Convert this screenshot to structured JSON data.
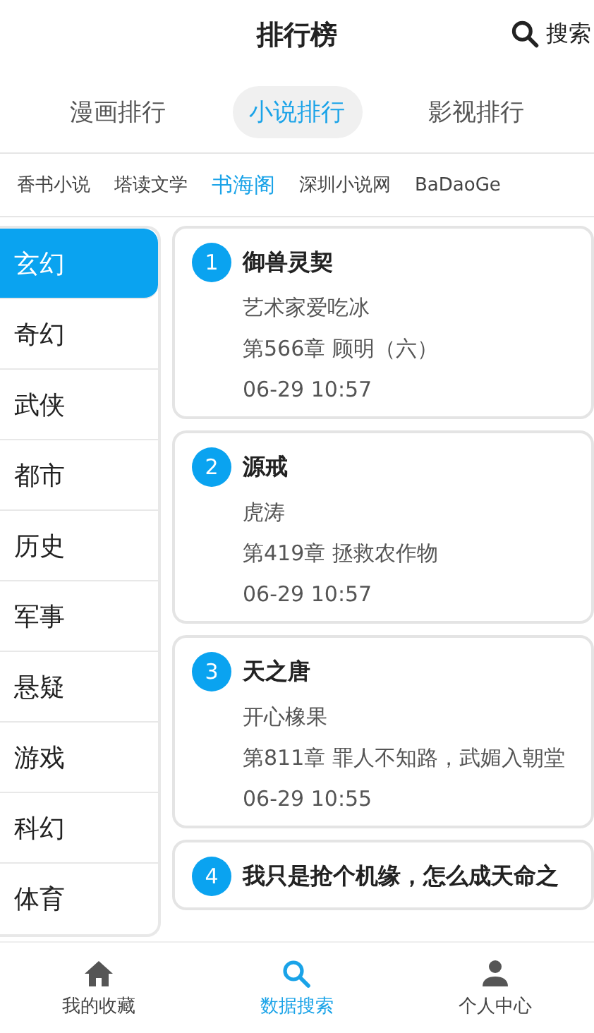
{
  "header": {
    "title": "排行榜",
    "search_label": "搜索"
  },
  "tabs": [
    {
      "label": "漫画排行",
      "selected": false
    },
    {
      "label": "小说排行",
      "selected": true
    },
    {
      "label": "影视排行",
      "selected": false
    }
  ],
  "sources": [
    {
      "label": "香书小说",
      "selected": false
    },
    {
      "label": "塔读文学",
      "selected": false
    },
    {
      "label": "书海阁",
      "selected": true
    },
    {
      "label": "深圳小说网",
      "selected": false
    },
    {
      "label": "BaDaoGe",
      "selected": false
    }
  ],
  "categories": [
    {
      "label": "玄幻",
      "selected": true
    },
    {
      "label": "奇幻",
      "selected": false
    },
    {
      "label": "武侠",
      "selected": false
    },
    {
      "label": "都市",
      "selected": false
    },
    {
      "label": "历史",
      "selected": false
    },
    {
      "label": "军事",
      "selected": false
    },
    {
      "label": "悬疑",
      "selected": false
    },
    {
      "label": "游戏",
      "selected": false
    },
    {
      "label": "科幻",
      "selected": false
    },
    {
      "label": "体育",
      "selected": false
    }
  ],
  "books": [
    {
      "rank": "1",
      "title": "御兽灵契",
      "author": "艺术家爱吃冰",
      "chapter": "第566章 顾明（六）",
      "time": "06-29 10:57"
    },
    {
      "rank": "2",
      "title": "源戒",
      "author": "虎涛",
      "chapter": "第419章 拯救农作物",
      "time": "06-29 10:57"
    },
    {
      "rank": "3",
      "title": "天之唐",
      "author": "开心橡果",
      "chapter": "第811章 罪人不知路，武媚入朝堂",
      "time": "06-29 10:55"
    },
    {
      "rank": "4",
      "title": "我只是抢个机缘，怎么成天命之"
    }
  ],
  "bottom_nav": [
    {
      "label": "我的收藏",
      "kind": "home",
      "selected": false
    },
    {
      "label": "数据搜索",
      "kind": "search",
      "selected": true
    },
    {
      "label": "个人中心",
      "kind": "person",
      "selected": false
    }
  ]
}
